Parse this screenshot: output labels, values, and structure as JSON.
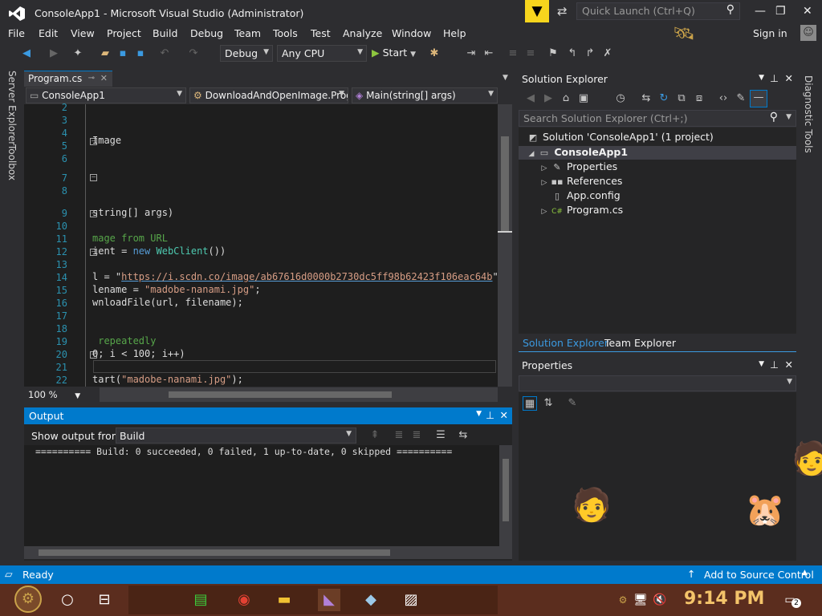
{
  "window": {
    "title": "ConsoleApp1 - Microsoft Visual Studio  (Administrator)",
    "quick_launch_placeholder": "Quick Launch (Ctrl+Q)"
  },
  "menu": [
    "File",
    "Edit",
    "View",
    "Project",
    "Build",
    "Debug",
    "Team",
    "Tools",
    "Test",
    "Analyze",
    "Window",
    "Help"
  ],
  "signin": "Sign in",
  "toolbar": {
    "config": "Debug",
    "platform": "Any CPU",
    "start": "Start"
  },
  "side_tabs": {
    "left": [
      "Server Explorer",
      "Toolbox"
    ],
    "right": [
      "Diagnostic Tools"
    ]
  },
  "editor": {
    "tab": "Program.cs",
    "nav": [
      "ConsoleApp1",
      "DownloadAndOpenImage.Prog",
      "Main(string[] args)"
    ],
    "zoom": "100 %",
    "line_numbers": [
      "2",
      "3",
      "4",
      "5",
      "6",
      "7",
      "8",
      "9",
      "10",
      "11",
      "12",
      "13",
      "14",
      "15",
      "16",
      "17",
      "18",
      "19",
      "20",
      "21",
      "22"
    ],
    "code": {
      "l5": "Image",
      "l9": "string[] args)",
      "l11": "mage from URL",
      "l12a": "ient = ",
      "l12b": "new",
      "l12c": " ",
      "l12d": "WebClient",
      "l12e": "())",
      "l14a": "l = \"",
      "l14b": "https://i.scdn.co/image/ab67616d0000b2730dc5ff98b62423f106eac64b",
      "l14c": "\";",
      "l15a": "lename = ",
      "l15b": "\"madobe-nanami.jpg\"",
      "l15c": ";",
      "l16": "wnloadFile(url, filename);",
      "l19": " repeatedly",
      "l20": "0; i < 100; i++)",
      "l22a": "tart(",
      "l22b": "\"madobe-nanami.jpg\"",
      "l22c": ");"
    }
  },
  "output": {
    "title": "Output",
    "show_from_label": "Show output from:",
    "source": "Build",
    "text": "========== Build: 0 succeeded, 0 failed, 1 up-to-date, 0 skipped =========="
  },
  "solution_explorer": {
    "title": "Solution Explorer",
    "search_placeholder": "Search Solution Explorer (Ctrl+;)",
    "solution": "Solution 'ConsoleApp1' (1 project)",
    "project": "ConsoleApp1",
    "items": [
      "Properties",
      "References",
      "App.config",
      "Program.cs"
    ],
    "tabs": [
      "Solution Explorer",
      "Team Explorer"
    ]
  },
  "properties": {
    "title": "Properties"
  },
  "status": {
    "left": "Ready",
    "right": "Add to Source Control"
  },
  "taskbar": {
    "time": "9:14 PM",
    "notifications": "2"
  },
  "colors": {
    "accent": "#007acc",
    "editor_bg": "#1e1e1e",
    "chrome_bg": "#2d2d30",
    "filter": "#f7d51d"
  }
}
